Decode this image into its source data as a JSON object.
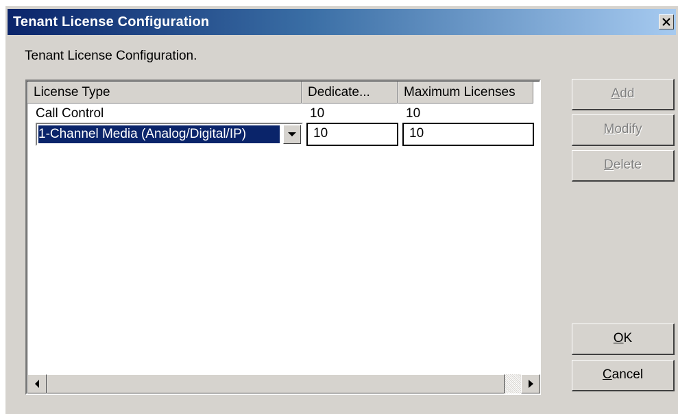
{
  "window": {
    "title": "Tenant License Configuration",
    "close_label": "X"
  },
  "description": "Tenant License Configuration.",
  "list": {
    "columns": [
      "License Type",
      "Dedicate...",
      "Maximum Licenses"
    ],
    "rows": [
      {
        "license_type": "Call Control",
        "dedicated": "10",
        "maximum": "10"
      }
    ],
    "edit_row": {
      "license_type": "1-Channel Media (Analog/Digital/IP)",
      "dedicated": "10",
      "maximum": "10"
    }
  },
  "buttons": {
    "add": {
      "mnemonic": "A",
      "rest": "dd",
      "enabled": false
    },
    "modify": {
      "mnemonic": "M",
      "rest": "odify",
      "enabled": false
    },
    "delete": {
      "mnemonic": "D",
      "rest": "elete",
      "enabled": false
    },
    "ok": {
      "mnemonic": "O",
      "rest": "K",
      "enabled": true
    },
    "cancel": {
      "mnemonic": "C",
      "rest": "ancel",
      "enabled": true
    }
  },
  "icons": {
    "close": "close-icon",
    "combo_arrow": "chevron-down-icon",
    "scroll_left": "arrow-left-icon",
    "scroll_right": "arrow-right-icon"
  }
}
